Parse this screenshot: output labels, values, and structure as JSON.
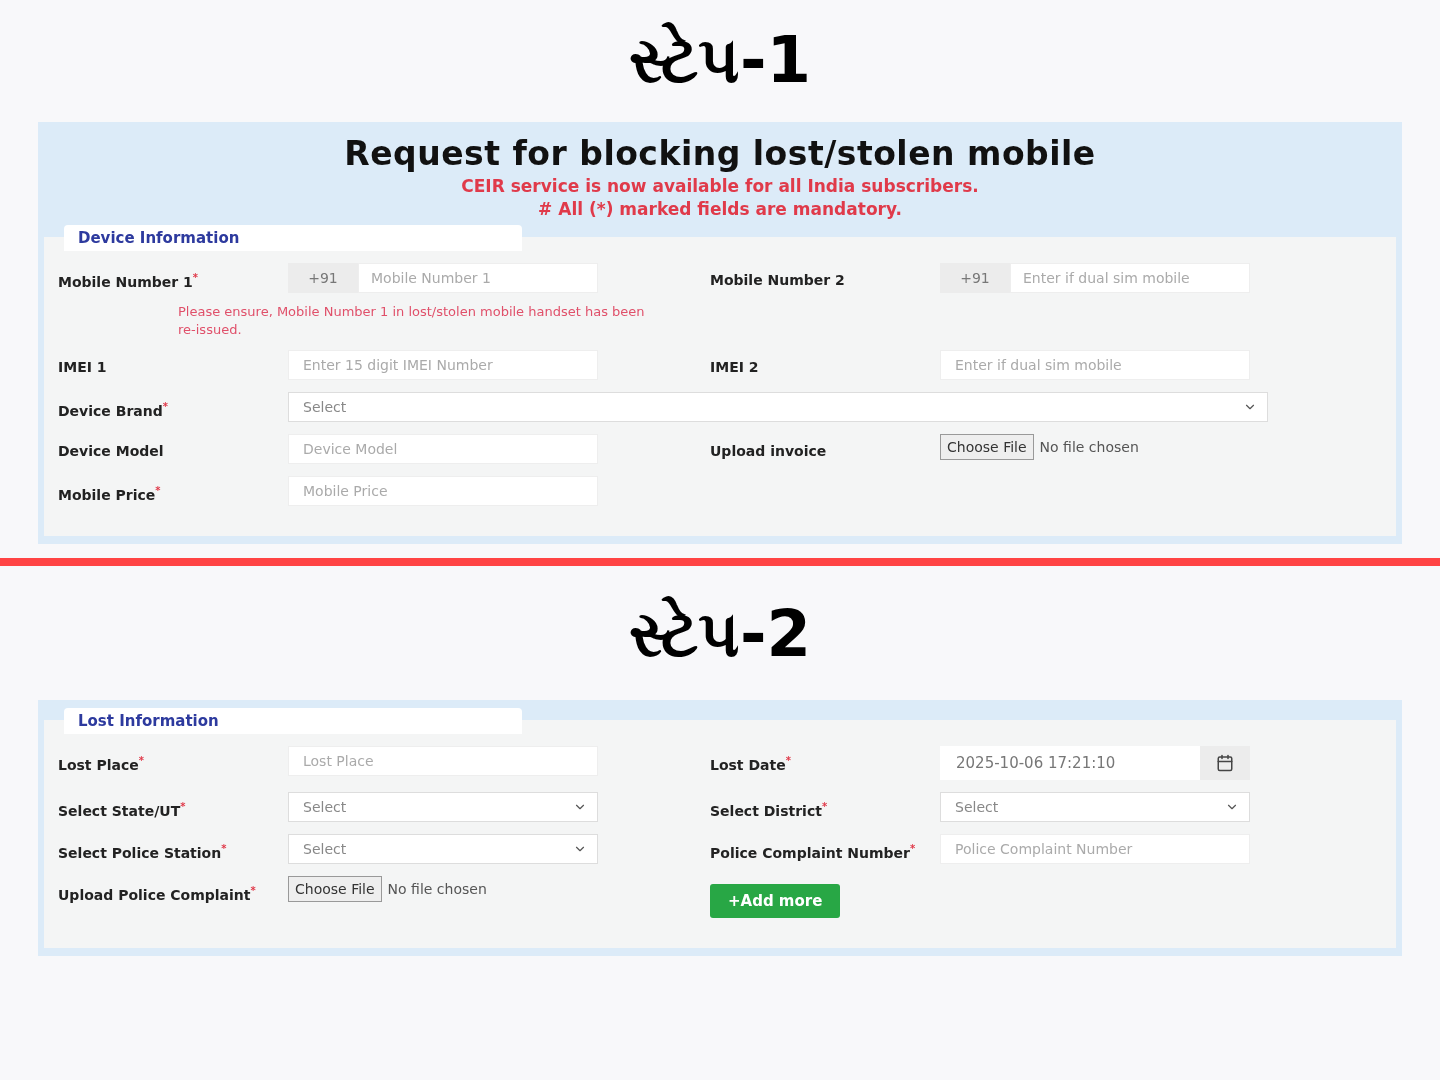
{
  "steps": [
    {
      "heading": "સ્ટેપ-1",
      "title": "Request for blocking lost/stolen mobile",
      "notices": [
        "CEIR service is now available for all India subscribers.",
        "# All (*) marked fields are mandatory."
      ],
      "section": "Device Information",
      "rows": [
        {
          "cells": [
            {
              "label": "Mobile Number 1",
              "mark": "*",
              "kind": "phone",
              "prefix": "+91",
              "placeholder": "Mobile Number 1",
              "note": "Please ensure, Mobile Number 1 in lost/stolen mobile handset has been re-issued."
            },
            {
              "label": "Mobile Number 2",
              "kind": "phone",
              "prefix": "+91",
              "placeholder": "Enter if dual sim mobile"
            }
          ]
        },
        {
          "cells": [
            {
              "label": "IMEI 1",
              "kind": "text",
              "placeholder": "Enter 15 digit IMEI Number"
            },
            {
              "label": "IMEI 2",
              "kind": "text",
              "placeholder": "Enter if dual sim mobile"
            }
          ]
        },
        {
          "cells": [
            {
              "label": "Device Brand",
              "mark": "*",
              "kind": "select",
              "value": "Select",
              "wide": true
            }
          ]
        },
        {
          "cells": [
            {
              "label": "Device Model",
              "kind": "text",
              "placeholder": "Device Model"
            },
            {
              "label": "Upload invoice",
              "kind": "file",
              "button": "Choose File",
              "status": "No file chosen"
            }
          ]
        },
        {
          "cells": [
            {
              "label": "Mobile Price",
              "mark": "*",
              "kind": "text",
              "placeholder": "Mobile Price"
            }
          ]
        }
      ]
    },
    {
      "heading": "સ્ટેપ-2",
      "section": "Lost Information",
      "rows": [
        {
          "cells": [
            {
              "label": "Lost Place",
              "mark": "*",
              "kind": "text",
              "placeholder": "Lost Place"
            },
            {
              "label": "Lost Date",
              "mark": "*",
              "kind": "date",
              "value": "2025-10-06 17:21:10"
            }
          ]
        },
        {
          "cells": [
            {
              "label": "Select State/UT",
              "mark": "*",
              "kind": "select",
              "value": "Select"
            },
            {
              "label": "Select District",
              "mark": "*",
              "kind": "select",
              "value": "Select"
            }
          ]
        },
        {
          "cells": [
            {
              "label": "Select Police Station",
              "mark": "*",
              "kind": "select",
              "value": "Select"
            },
            {
              "label": "Police Complaint Number",
              "mark": "*",
              "kind": "text",
              "placeholder": "Police Complaint Number"
            }
          ]
        },
        {
          "cells": [
            {
              "label": "Upload Police Complaint",
              "mark": "*",
              "kind": "file",
              "button": "Choose File",
              "status": "No file chosen"
            },
            {
              "kind": "button",
              "button": "+Add more"
            }
          ]
        }
      ]
    }
  ]
}
